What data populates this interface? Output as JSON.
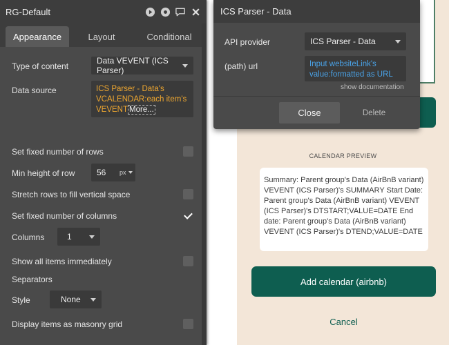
{
  "panel": {
    "title": "RG-Default",
    "tabs": [
      {
        "label": "Appearance",
        "active": true
      },
      {
        "label": "Layout",
        "active": false
      },
      {
        "label": "Conditional",
        "active": false
      }
    ],
    "type_of_content": {
      "label": "Type of content",
      "value": "Data VEVENT (ICS Parser)"
    },
    "data_source": {
      "label": "Data source",
      "expression": "ICS Parser - Data's VCALENDAR:each item's VEVENT",
      "more_label": "More..."
    },
    "fixed_rows": {
      "label": "Set fixed number of rows",
      "checked": false
    },
    "min_height": {
      "label": "Min height of row",
      "value": "56",
      "unit": "px"
    },
    "stretch_rows": {
      "label": "Stretch rows to fill vertical space",
      "checked": false
    },
    "fixed_columns": {
      "label": "Set fixed number of columns",
      "checked": true
    },
    "columns": {
      "label": "Columns",
      "value": "1"
    },
    "show_all": {
      "label": "Show all items immediately",
      "checked": false
    },
    "separators": {
      "label": "Separators"
    },
    "style": {
      "label": "Style",
      "value": "None"
    },
    "masonry": {
      "label": "Display items as masonry grid",
      "checked": false
    }
  },
  "popup": {
    "title": "ICS Parser - Data",
    "api_provider": {
      "label": "API provider",
      "value": "ICS Parser - Data"
    },
    "path_url": {
      "label": "(path) url",
      "value": "Input websiteLink's value:formatted as URL"
    },
    "show_documentation": "show documentation",
    "close_label": "Close",
    "delete_label": "Delete"
  },
  "canvas": {
    "preview_title": "CALENDAR PREVIEW",
    "preview_text": "Summary: Parent group's Data (AirBnB variant) VEVENT (ICS Parser)'s SUMMARY Start Date: Parent group's Data (AirBnB variant) VEVENT (ICS Parser)'s DTSTART;VALUE=DATE End date: Parent group's Data (AirBnB variant) VEVENT (ICS Parser)'s DTEND;VALUE=DATE",
    "add_button": "Add calendar (airbnb)",
    "cancel_link": "Cancel"
  },
  "colors": {
    "panel_bg": "#4a4a4a",
    "accent_orange": "#f0a830",
    "link_blue": "#4aa3e8",
    "primary_green": "#0e5e50",
    "canvas_bg": "#f3e6d8"
  },
  "icons": [
    "play-icon",
    "eye-icon",
    "comment-icon",
    "close-icon",
    "caret-down-icon",
    "checkmark-icon"
  ]
}
